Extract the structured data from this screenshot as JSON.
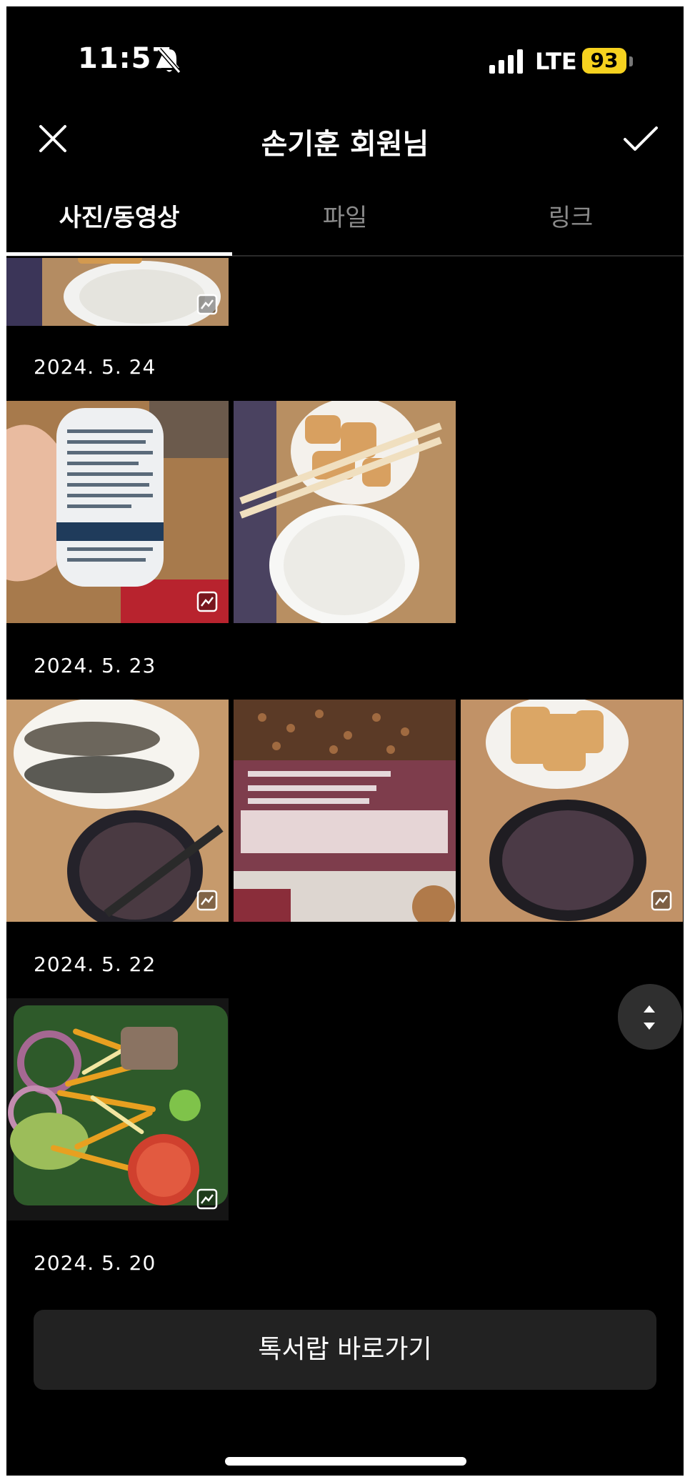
{
  "status_bar": {
    "time": "11:57",
    "network": "LTE",
    "battery": "93",
    "battery_color": "#f6d21f"
  },
  "header": {
    "title": "손기훈 회원님",
    "close_icon": "close-icon",
    "confirm_icon": "check-icon"
  },
  "tabs": [
    {
      "label": "사진/동영상",
      "active": true
    },
    {
      "label": "파일",
      "active": false
    },
    {
      "label": "링크",
      "active": false
    }
  ],
  "gallery": {
    "dates": [
      "2024. 5. 24",
      "2024. 5. 23",
      "2024. 5. 22",
      "2024. 5. 20"
    ],
    "photo_icon": "photo-type-icon"
  },
  "scroll_control": {
    "up_icon": "scroll-up-icon",
    "down_icon": "scroll-down-icon"
  },
  "bottom_button": {
    "label": "톡서랍 바로가기"
  }
}
